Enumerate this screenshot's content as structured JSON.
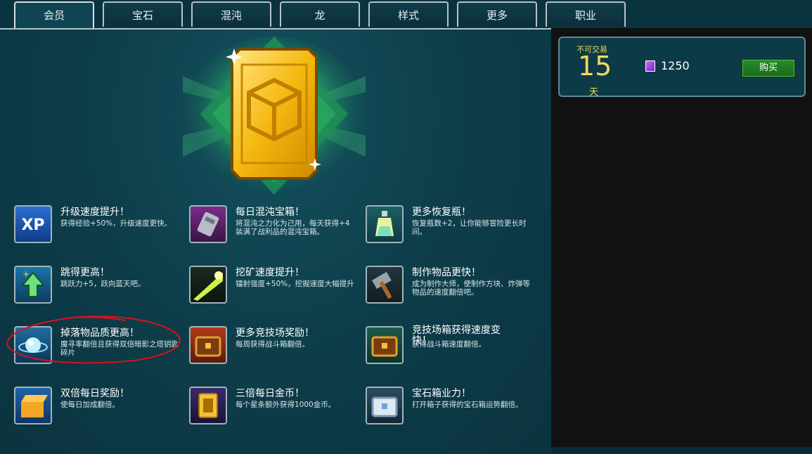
{
  "tabs": [
    {
      "label": "会员",
      "active": true
    },
    {
      "label": "宝石",
      "active": false
    },
    {
      "label": "混沌",
      "active": false
    },
    {
      "label": "龙",
      "active": false
    },
    {
      "label": "样式",
      "active": false
    },
    {
      "label": "更多",
      "active": false
    },
    {
      "label": "职业",
      "active": false
    }
  ],
  "offer": {
    "tradable": "不可交易",
    "days": "15",
    "unit": "天",
    "price": "1250",
    "buy_label": "购买"
  },
  "features": [
    {
      "title": "升级速度提升！",
      "desc": "获得经验+50%，升级速度更快。",
      "icon": "xp-icon"
    },
    {
      "title": "每日混沌宝箱！",
      "desc": "将混沌之力化为己用，每天获得+4装满了战利品的混沌宝箱。",
      "icon": "chaos-chest-icon"
    },
    {
      "title": "更多恢复瓶！",
      "desc": "恢复瓶数+2，让你能够冒险更长时间。",
      "icon": "potion-icon"
    },
    {
      "title": "跳得更高！",
      "desc": "跳跃力+5，跃向蓝天吧。",
      "icon": "jump-arrow-icon"
    },
    {
      "title": "挖矿速度提升！",
      "desc": "镭射强度+50%，挖掘速度大幅提升",
      "icon": "laser-icon"
    },
    {
      "title": "制作物品更快！",
      "desc": "成为制作大师，使制作方块、炸弹等物品的速度翻倍吧。",
      "icon": "hammer-icon"
    },
    {
      "title": "掉落物品质更高！",
      "desc": "魔寻率翻倍且获得双倍暗影之塔钥匙碎片",
      "icon": "magic-orb-icon"
    },
    {
      "title": "更多竞技场奖励！",
      "desc": "每周获得战斗箱翻倍。",
      "icon": "battle-chest-icon"
    },
    {
      "title": "竞技场箱获得速度变快！",
      "desc": "获得战斗箱速度翻倍。",
      "icon": "arena-chest-icon"
    },
    {
      "title": "双倍每日奖励！",
      "desc": "使每日加成翻倍。",
      "icon": "daily-box-icon"
    },
    {
      "title": "三倍每日金币！",
      "desc": "每个星条额外获得1000金币。",
      "icon": "gold-coin-icon"
    },
    {
      "title": "宝石箱业力！",
      "desc": "打开箱子获得的宝石箱运势翻倍。",
      "icon": "gem-chest-icon"
    }
  ],
  "colors": {
    "accent_gold": "#f2d85a",
    "buy_green": "#2b8a2b",
    "annotation_red": "#d8121a"
  }
}
